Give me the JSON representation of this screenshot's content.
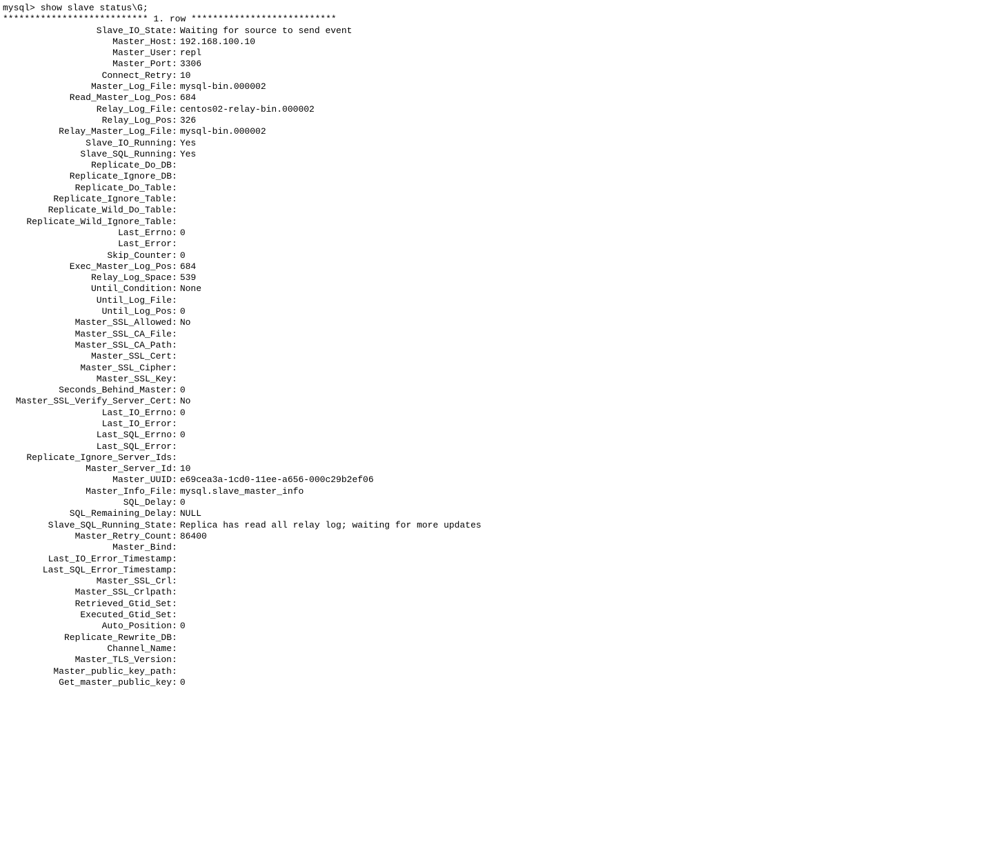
{
  "prompt": "mysql> ",
  "command": "show slave status\\G;",
  "row_separator": "*************************** 1. row ***************************",
  "fields": [
    {
      "key": "Slave_IO_State",
      "value": "Waiting for source to send event"
    },
    {
      "key": "Master_Host",
      "value": "192.168.100.10"
    },
    {
      "key": "Master_User",
      "value": "repl"
    },
    {
      "key": "Master_Port",
      "value": "3306"
    },
    {
      "key": "Connect_Retry",
      "value": "10"
    },
    {
      "key": "Master_Log_File",
      "value": "mysql-bin.000002"
    },
    {
      "key": "Read_Master_Log_Pos",
      "value": "684"
    },
    {
      "key": "Relay_Log_File",
      "value": "centos02-relay-bin.000002"
    },
    {
      "key": "Relay_Log_Pos",
      "value": "326"
    },
    {
      "key": "Relay_Master_Log_File",
      "value": "mysql-bin.000002"
    },
    {
      "key": "Slave_IO_Running",
      "value": "Yes"
    },
    {
      "key": "Slave_SQL_Running",
      "value": "Yes"
    },
    {
      "key": "Replicate_Do_DB",
      "value": ""
    },
    {
      "key": "Replicate_Ignore_DB",
      "value": ""
    },
    {
      "key": "Replicate_Do_Table",
      "value": ""
    },
    {
      "key": "Replicate_Ignore_Table",
      "value": ""
    },
    {
      "key": "Replicate_Wild_Do_Table",
      "value": ""
    },
    {
      "key": "Replicate_Wild_Ignore_Table",
      "value": ""
    },
    {
      "key": "Last_Errno",
      "value": "0"
    },
    {
      "key": "Last_Error",
      "value": ""
    },
    {
      "key": "Skip_Counter",
      "value": "0"
    },
    {
      "key": "Exec_Master_Log_Pos",
      "value": "684"
    },
    {
      "key": "Relay_Log_Space",
      "value": "539"
    },
    {
      "key": "Until_Condition",
      "value": "None"
    },
    {
      "key": "Until_Log_File",
      "value": ""
    },
    {
      "key": "Until_Log_Pos",
      "value": "0"
    },
    {
      "key": "Master_SSL_Allowed",
      "value": "No"
    },
    {
      "key": "Master_SSL_CA_File",
      "value": ""
    },
    {
      "key": "Master_SSL_CA_Path",
      "value": ""
    },
    {
      "key": "Master_SSL_Cert",
      "value": ""
    },
    {
      "key": "Master_SSL_Cipher",
      "value": ""
    },
    {
      "key": "Master_SSL_Key",
      "value": ""
    },
    {
      "key": "Seconds_Behind_Master",
      "value": "0"
    },
    {
      "key": "Master_SSL_Verify_Server_Cert",
      "value": "No"
    },
    {
      "key": "Last_IO_Errno",
      "value": "0"
    },
    {
      "key": "Last_IO_Error",
      "value": ""
    },
    {
      "key": "Last_SQL_Errno",
      "value": "0"
    },
    {
      "key": "Last_SQL_Error",
      "value": ""
    },
    {
      "key": "Replicate_Ignore_Server_Ids",
      "value": ""
    },
    {
      "key": "Master_Server_Id",
      "value": "10"
    },
    {
      "key": "Master_UUID",
      "value": "e69cea3a-1cd0-11ee-a656-000c29b2ef06"
    },
    {
      "key": "Master_Info_File",
      "value": "mysql.slave_master_info"
    },
    {
      "key": "SQL_Delay",
      "value": "0"
    },
    {
      "key": "SQL_Remaining_Delay",
      "value": "NULL"
    },
    {
      "key": "Slave_SQL_Running_State",
      "value": "Replica has read all relay log; waiting for more updates"
    },
    {
      "key": "Master_Retry_Count",
      "value": "86400"
    },
    {
      "key": "Master_Bind",
      "value": ""
    },
    {
      "key": "Last_IO_Error_Timestamp",
      "value": ""
    },
    {
      "key": "Last_SQL_Error_Timestamp",
      "value": ""
    },
    {
      "key": "Master_SSL_Crl",
      "value": ""
    },
    {
      "key": "Master_SSL_Crlpath",
      "value": ""
    },
    {
      "key": "Retrieved_Gtid_Set",
      "value": ""
    },
    {
      "key": "Executed_Gtid_Set",
      "value": ""
    },
    {
      "key": "Auto_Position",
      "value": "0"
    },
    {
      "key": "Replicate_Rewrite_DB",
      "value": ""
    },
    {
      "key": "Channel_Name",
      "value": ""
    },
    {
      "key": "Master_TLS_Version",
      "value": ""
    },
    {
      "key": "Master_public_key_path",
      "value": ""
    },
    {
      "key": "Get_master_public_key",
      "value": "0"
    }
  ]
}
